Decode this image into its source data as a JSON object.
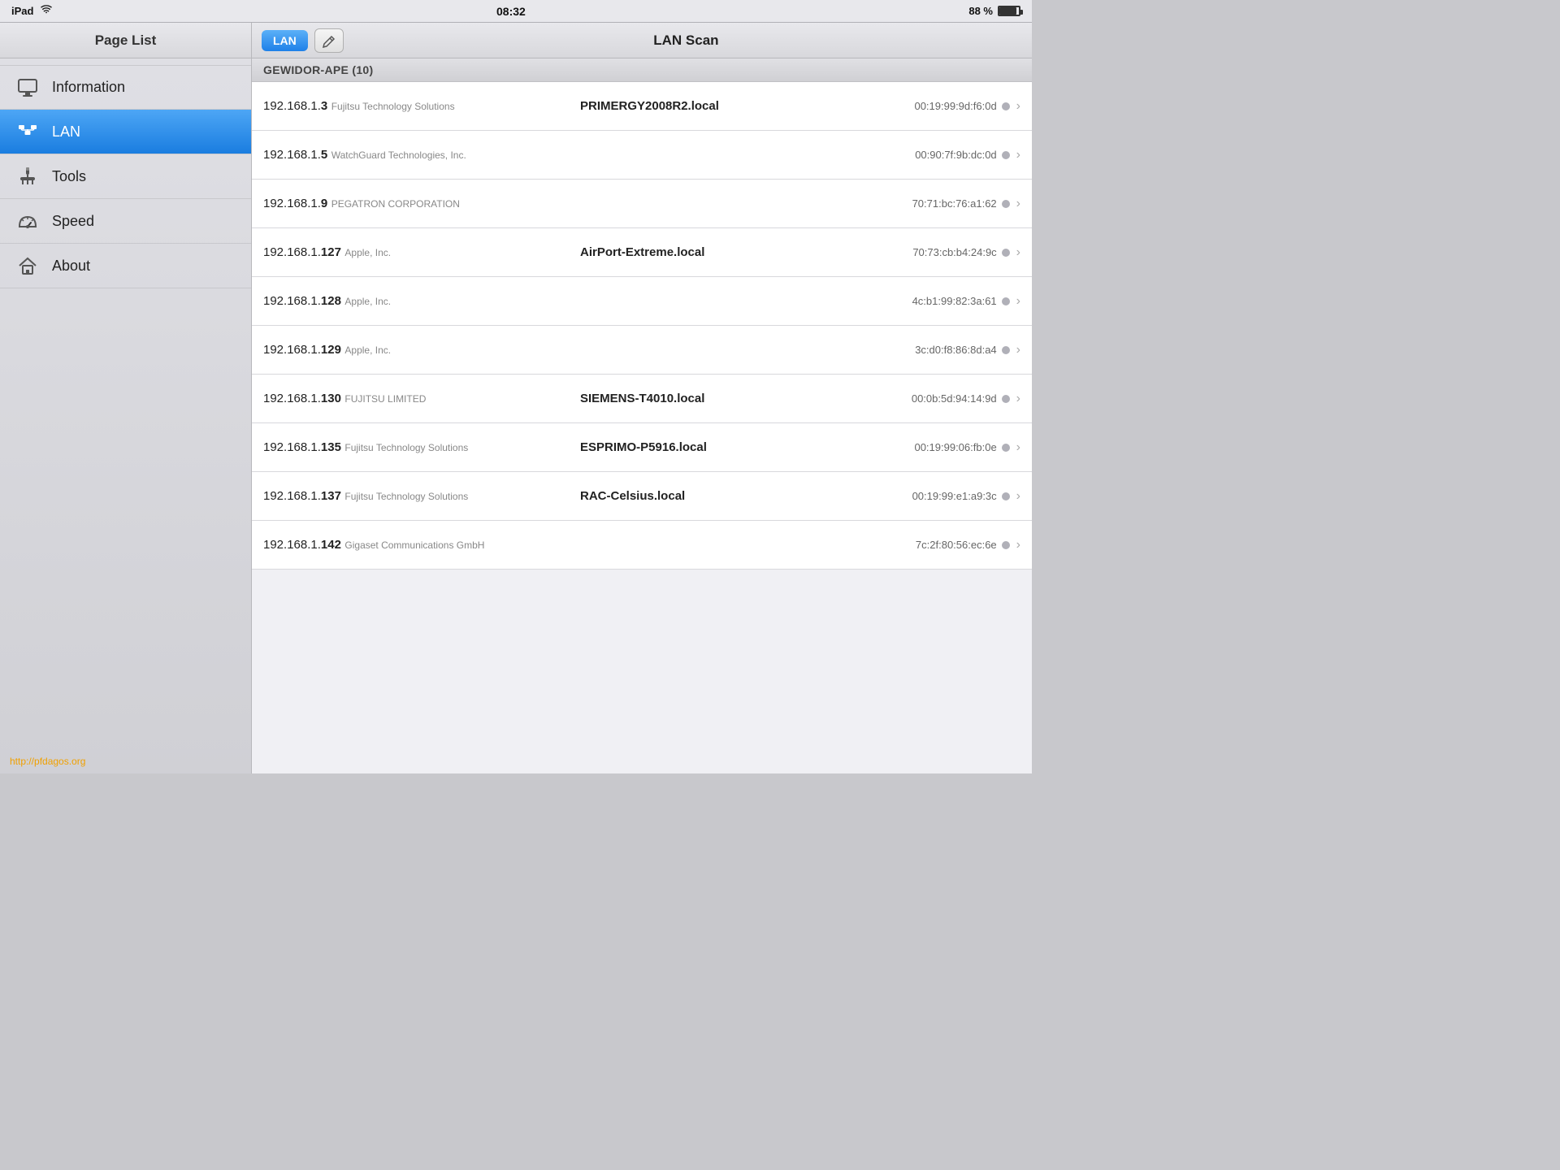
{
  "statusBar": {
    "device": "iPad",
    "wifi": "wifi",
    "time": "08:32",
    "battery_pct": "88 %"
  },
  "sidebar": {
    "title": "Page List",
    "items": [
      {
        "id": "information",
        "label": "Information",
        "icon": "monitor"
      },
      {
        "id": "lan",
        "label": "LAN",
        "icon": "lan",
        "active": true
      },
      {
        "id": "tools",
        "label": "Tools",
        "icon": "tools"
      },
      {
        "id": "speed",
        "label": "Speed",
        "icon": "speed"
      },
      {
        "id": "about",
        "label": "About",
        "icon": "home"
      }
    ],
    "footer_link": "http://pfdagos.org"
  },
  "topBar": {
    "lan_button": "LAN",
    "title": "LAN Scan"
  },
  "scan": {
    "group": "GEWIDOR-APE (10)",
    "devices": [
      {
        "ip_prefix": "192.168.1.",
        "ip_host": "3",
        "hostname": "PRIMERGY2008R2.local",
        "vendor": "Fujitsu Technology Solutions",
        "mac": "00:19:99:9d:f6:0d"
      },
      {
        "ip_prefix": "192.168.1.",
        "ip_host": "5",
        "hostname": "",
        "vendor": "WatchGuard Technologies, Inc.",
        "mac": "00:90:7f:9b:dc:0d"
      },
      {
        "ip_prefix": "192.168.1.",
        "ip_host": "9",
        "hostname": "",
        "vendor": "PEGATRON CORPORATION",
        "mac": "70:71:bc:76:a1:62"
      },
      {
        "ip_prefix": "192.168.1.",
        "ip_host": "127",
        "hostname": "AirPort-Extreme.local",
        "vendor": "Apple, Inc.",
        "mac": "70:73:cb:b4:24:9c"
      },
      {
        "ip_prefix": "192.168.1.",
        "ip_host": "128",
        "hostname": "",
        "vendor": "Apple, Inc.",
        "mac": "4c:b1:99:82:3a:61"
      },
      {
        "ip_prefix": "192.168.1.",
        "ip_host": "129",
        "hostname": "",
        "vendor": "Apple, Inc.",
        "mac": "3c:d0:f8:86:8d:a4"
      },
      {
        "ip_prefix": "192.168.1.",
        "ip_host": "130",
        "hostname": "SIEMENS-T4010.local",
        "vendor": "FUJITSU LIMITED",
        "mac": "00:0b:5d:94:14:9d"
      },
      {
        "ip_prefix": "192.168.1.",
        "ip_host": "135",
        "hostname": "ESPRIMO-P5916.local",
        "vendor": "Fujitsu Technology Solutions",
        "mac": "00:19:99:06:fb:0e"
      },
      {
        "ip_prefix": "192.168.1.",
        "ip_host": "137",
        "hostname": "RAC-Celsius.local",
        "vendor": "Fujitsu Technology Solutions",
        "mac": "00:19:99:e1:a9:3c"
      },
      {
        "ip_prefix": "192.168.1.",
        "ip_host": "142",
        "hostname": "",
        "vendor": "Gigaset Communications GmbH",
        "mac": "7c:2f:80:56:ec:6e"
      }
    ]
  }
}
